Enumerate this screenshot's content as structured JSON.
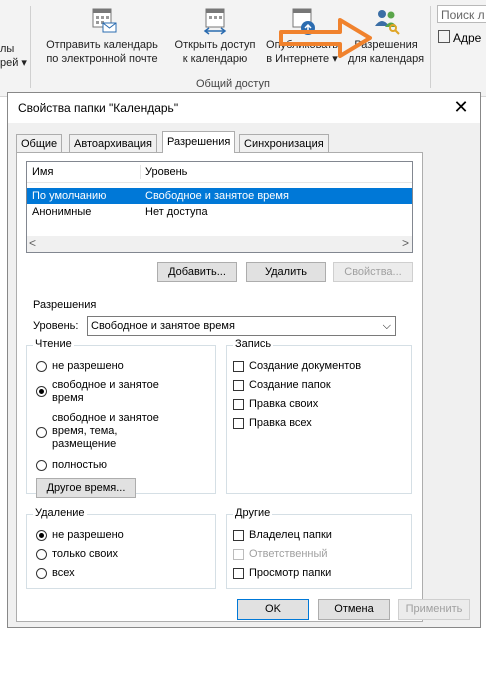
{
  "ribbon": {
    "partial_left": [
      "лы",
      "рей ▾"
    ],
    "send_calendar": "Отправить календарь\nпо электронной почте",
    "open_shared": "Открыть доступ\nк календарю",
    "publish": "Опубликовать\nв Интернете ▾",
    "permissions": "Разрешения\nдля календаря",
    "group_label": "Общий доступ",
    "search_placeholder": "Поиск л",
    "address_label": "Адре"
  },
  "dialog": {
    "title": "Свойства папки \"Календарь\"",
    "close": "✕",
    "tabs": [
      "Общие",
      "Автоархивация",
      "Разрешения",
      "Синхронизация"
    ],
    "active_tab": 2,
    "list": {
      "col_name": "Имя",
      "col_level": "Уровень",
      "rows": [
        {
          "name": "По умолчанию",
          "level": "Свободное и занятое время",
          "selected": true
        },
        {
          "name": "Анонимные",
          "level": "Нет доступа",
          "selected": false
        }
      ]
    },
    "buttons": {
      "add": "Добавить...",
      "remove": "Удалить",
      "properties": "Свойства..."
    },
    "permissions": {
      "group_title": "Разрешения",
      "level_label": "Уровень:",
      "level_value": "Свободное и занятое время",
      "read": {
        "title": "Чтение",
        "options": [
          "не разрешено",
          "свободное и занятое\nвремя",
          "свободное и занятое\nвремя, тема,\nразмещение",
          "полностью"
        ],
        "selected": 1,
        "other_time": "Другое время..."
      },
      "write": {
        "title": "Запись",
        "options": [
          "Создание документов",
          "Создание папок",
          "Правка своих",
          "Правка всех"
        ]
      },
      "delete": {
        "title": "Удаление",
        "options": [
          "не разрешено",
          "только своих",
          "всех"
        ],
        "selected": 0
      },
      "other": {
        "title": "Другие",
        "options": [
          "Владелец папки",
          "Ответственный",
          "Просмотр папки"
        ],
        "disabled_index": 1
      }
    },
    "footer": {
      "ok": "OK",
      "cancel": "Отмена",
      "apply": "Применить"
    }
  },
  "colors": {
    "accent": "#0078d7",
    "arrow": "#f0822d"
  }
}
